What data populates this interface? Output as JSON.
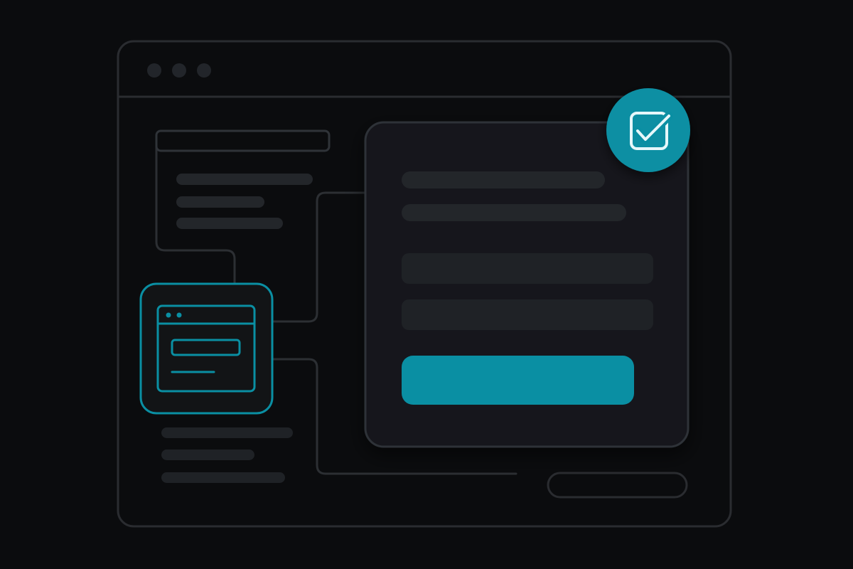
{
  "colors": {
    "background": "#0b0c0e",
    "window_frame": "#2a2c30",
    "window_chrome_dot": "#22252a",
    "panel": "#16181b",
    "panel_border": "#2f3338",
    "placeholder_bar": "#23262a",
    "connector": "#2c2f33",
    "accent": "#0a8fa3",
    "accent_light": "#bfe9ef"
  },
  "icons": {
    "app_icon": "browser-window-icon",
    "check": "checkbox-checked-icon",
    "window_dots": "window-controls-icon"
  },
  "form": {
    "text_lines": 2,
    "input_fields": 2,
    "submit_button": "primary-action"
  },
  "sidebar": {
    "top_placeholder_lines": 3,
    "bottom_placeholder_lines": 3
  }
}
